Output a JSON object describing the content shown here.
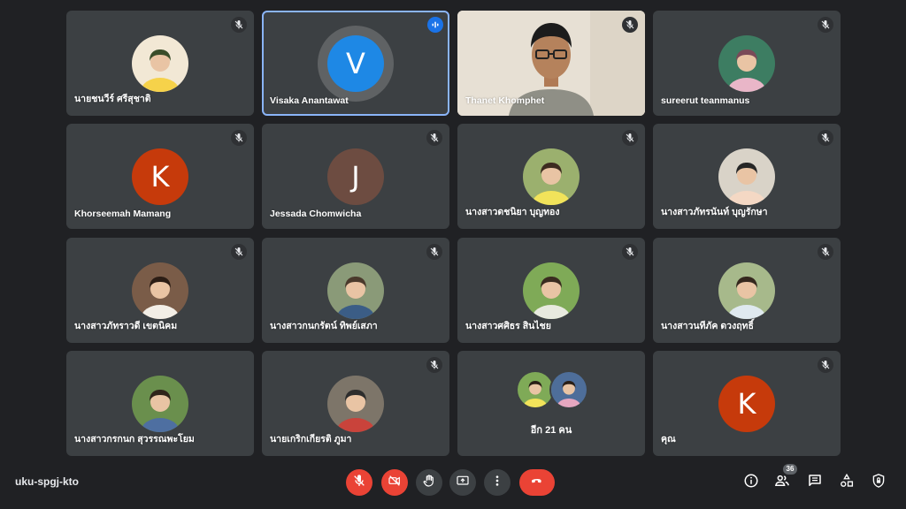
{
  "meeting": {
    "code": "uku-spgj-kto"
  },
  "participants": [
    {
      "name": "นายชนวีร์ ศรีสุชาติ",
      "avatar": "photo",
      "icon": "mic-off-icon"
    },
    {
      "name": "Visaka Anantawat",
      "avatar": "letter",
      "letter": "V",
      "color": "#1e88e5",
      "speaking": true,
      "icon": "audio-wave-icon"
    },
    {
      "name": "Thanet Khomphet",
      "avatar": "video",
      "icon": "mic-off-icon"
    },
    {
      "name": "sureerut teanmanus",
      "avatar": "photo",
      "icon": "mic-off-icon"
    },
    {
      "name": "Khorseemah Mamang",
      "avatar": "letter",
      "letter": "K",
      "color": "#c63a0b",
      "icon": "mic-off-icon"
    },
    {
      "name": "Jessada Chomwicha",
      "avatar": "letter",
      "letter": "J",
      "color": "#6d4c41",
      "icon": "mic-off-icon"
    },
    {
      "name": "นางสาวดชนิยา บุญทอง",
      "avatar": "photo",
      "icon": "mic-off-icon"
    },
    {
      "name": "นางสาวภัทรนันท์ บุญรักษา",
      "avatar": "photo",
      "icon": "mic-off-icon"
    },
    {
      "name": "นางสาวภัทราวดี เขตนิคม",
      "avatar": "photo",
      "icon": "mic-off-icon"
    },
    {
      "name": "นางสาวกนกรัตน์ ทิพย์เสภา",
      "avatar": "photo",
      "icon": "mic-off-icon"
    },
    {
      "name": "นางสาวศศิธร สินไชย",
      "avatar": "photo",
      "icon": "mic-off-icon"
    },
    {
      "name": "นางสาวนทีภัค ดวงฤทธิ์",
      "avatar": "photo",
      "icon": "mic-off-icon"
    },
    {
      "name": "นางสาวกรกนก สุวรรณพะโยม",
      "avatar": "photo"
    },
    {
      "name": "นายเกริกเกียรติ ภูมา",
      "avatar": "photo",
      "icon": "mic-off-icon"
    },
    {
      "name": "อีก 21 คน",
      "avatar": "others"
    },
    {
      "name": "คุณ",
      "avatar": "letter",
      "letter": "K",
      "color": "#c63a0b",
      "icon": "mic-off-icon"
    }
  ],
  "controls": {
    "mic": {
      "icon": "mic-off-icon",
      "state": "off",
      "color": "#ea4335"
    },
    "camera": {
      "icon": "camera-off-icon",
      "state": "off",
      "color": "#ea4335"
    },
    "raise_hand": {
      "icon": "hand-icon"
    },
    "present": {
      "icon": "present-screen-icon"
    },
    "more": {
      "icon": "more-vert-icon"
    },
    "leave": {
      "icon": "hang-up-icon",
      "color": "#ea4335"
    }
  },
  "right_tools": {
    "info": {
      "icon": "info-icon"
    },
    "people": {
      "icon": "people-icon",
      "count": "36"
    },
    "chat": {
      "icon": "chat-icon"
    },
    "activities": {
      "icon": "activities-icon"
    },
    "host_controls": {
      "icon": "shield-lock-icon"
    }
  }
}
